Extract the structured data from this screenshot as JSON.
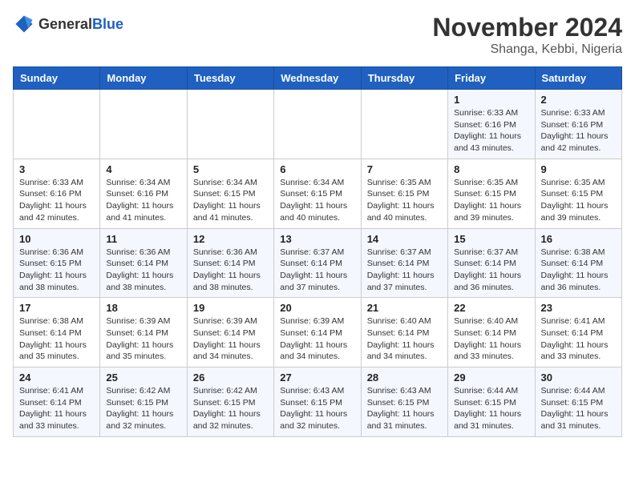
{
  "logo": {
    "general": "General",
    "blue": "Blue"
  },
  "title": "November 2024",
  "location": "Shanga, Kebbi, Nigeria",
  "days_of_week": [
    "Sunday",
    "Monday",
    "Tuesday",
    "Wednesday",
    "Thursday",
    "Friday",
    "Saturday"
  ],
  "weeks": [
    [
      {
        "day": "",
        "info": ""
      },
      {
        "day": "",
        "info": ""
      },
      {
        "day": "",
        "info": ""
      },
      {
        "day": "",
        "info": ""
      },
      {
        "day": "",
        "info": ""
      },
      {
        "day": "1",
        "info": "Sunrise: 6:33 AM\nSunset: 6:16 PM\nDaylight: 11 hours and 43 minutes."
      },
      {
        "day": "2",
        "info": "Sunrise: 6:33 AM\nSunset: 6:16 PM\nDaylight: 11 hours and 42 minutes."
      }
    ],
    [
      {
        "day": "3",
        "info": "Sunrise: 6:33 AM\nSunset: 6:16 PM\nDaylight: 11 hours and 42 minutes."
      },
      {
        "day": "4",
        "info": "Sunrise: 6:34 AM\nSunset: 6:16 PM\nDaylight: 11 hours and 41 minutes."
      },
      {
        "day": "5",
        "info": "Sunrise: 6:34 AM\nSunset: 6:15 PM\nDaylight: 11 hours and 41 minutes."
      },
      {
        "day": "6",
        "info": "Sunrise: 6:34 AM\nSunset: 6:15 PM\nDaylight: 11 hours and 40 minutes."
      },
      {
        "day": "7",
        "info": "Sunrise: 6:35 AM\nSunset: 6:15 PM\nDaylight: 11 hours and 40 minutes."
      },
      {
        "day": "8",
        "info": "Sunrise: 6:35 AM\nSunset: 6:15 PM\nDaylight: 11 hours and 39 minutes."
      },
      {
        "day": "9",
        "info": "Sunrise: 6:35 AM\nSunset: 6:15 PM\nDaylight: 11 hours and 39 minutes."
      }
    ],
    [
      {
        "day": "10",
        "info": "Sunrise: 6:36 AM\nSunset: 6:15 PM\nDaylight: 11 hours and 38 minutes."
      },
      {
        "day": "11",
        "info": "Sunrise: 6:36 AM\nSunset: 6:14 PM\nDaylight: 11 hours and 38 minutes."
      },
      {
        "day": "12",
        "info": "Sunrise: 6:36 AM\nSunset: 6:14 PM\nDaylight: 11 hours and 38 minutes."
      },
      {
        "day": "13",
        "info": "Sunrise: 6:37 AM\nSunset: 6:14 PM\nDaylight: 11 hours and 37 minutes."
      },
      {
        "day": "14",
        "info": "Sunrise: 6:37 AM\nSunset: 6:14 PM\nDaylight: 11 hours and 37 minutes."
      },
      {
        "day": "15",
        "info": "Sunrise: 6:37 AM\nSunset: 6:14 PM\nDaylight: 11 hours and 36 minutes."
      },
      {
        "day": "16",
        "info": "Sunrise: 6:38 AM\nSunset: 6:14 PM\nDaylight: 11 hours and 36 minutes."
      }
    ],
    [
      {
        "day": "17",
        "info": "Sunrise: 6:38 AM\nSunset: 6:14 PM\nDaylight: 11 hours and 35 minutes."
      },
      {
        "day": "18",
        "info": "Sunrise: 6:39 AM\nSunset: 6:14 PM\nDaylight: 11 hours and 35 minutes."
      },
      {
        "day": "19",
        "info": "Sunrise: 6:39 AM\nSunset: 6:14 PM\nDaylight: 11 hours and 34 minutes."
      },
      {
        "day": "20",
        "info": "Sunrise: 6:39 AM\nSunset: 6:14 PM\nDaylight: 11 hours and 34 minutes."
      },
      {
        "day": "21",
        "info": "Sunrise: 6:40 AM\nSunset: 6:14 PM\nDaylight: 11 hours and 34 minutes."
      },
      {
        "day": "22",
        "info": "Sunrise: 6:40 AM\nSunset: 6:14 PM\nDaylight: 11 hours and 33 minutes."
      },
      {
        "day": "23",
        "info": "Sunrise: 6:41 AM\nSunset: 6:14 PM\nDaylight: 11 hours and 33 minutes."
      }
    ],
    [
      {
        "day": "24",
        "info": "Sunrise: 6:41 AM\nSunset: 6:14 PM\nDaylight: 11 hours and 33 minutes."
      },
      {
        "day": "25",
        "info": "Sunrise: 6:42 AM\nSunset: 6:15 PM\nDaylight: 11 hours and 32 minutes."
      },
      {
        "day": "26",
        "info": "Sunrise: 6:42 AM\nSunset: 6:15 PM\nDaylight: 11 hours and 32 minutes."
      },
      {
        "day": "27",
        "info": "Sunrise: 6:43 AM\nSunset: 6:15 PM\nDaylight: 11 hours and 32 minutes."
      },
      {
        "day": "28",
        "info": "Sunrise: 6:43 AM\nSunset: 6:15 PM\nDaylight: 11 hours and 31 minutes."
      },
      {
        "day": "29",
        "info": "Sunrise: 6:44 AM\nSunset: 6:15 PM\nDaylight: 11 hours and 31 minutes."
      },
      {
        "day": "30",
        "info": "Sunrise: 6:44 AM\nSunset: 6:15 PM\nDaylight: 11 hours and 31 minutes."
      }
    ]
  ]
}
